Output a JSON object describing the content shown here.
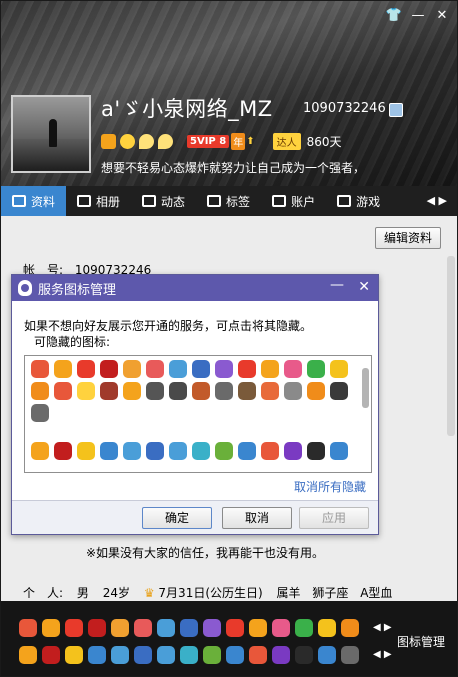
{
  "window": {
    "title_buttons": [
      "shirt-icon",
      "minimize-icon",
      "close-icon"
    ]
  },
  "profile": {
    "nickname": "a'ゞ小泉网络_MZ",
    "qq_number": "1090732246",
    "vip_badge": "5VIP 8",
    "year_badge": "年",
    "daren_label": "达人",
    "days": "860天",
    "signature": "想要不轻易心态爆炸就努力让自己成为一个强者，"
  },
  "tabs": [
    {
      "label": "资料",
      "icon": "card-icon",
      "active": true
    },
    {
      "label": "相册",
      "icon": "photo-icon"
    },
    {
      "label": "动态",
      "icon": "list-icon"
    },
    {
      "label": "标签",
      "icon": "bookmark-icon"
    },
    {
      "label": "账户",
      "icon": "wallet-icon"
    },
    {
      "label": "游戏",
      "icon": "game-icon"
    }
  ],
  "content": {
    "edit_button": "编辑资料",
    "account_label": "帐　号:",
    "account_value": "1090732246",
    "quote": "※如果没有大家的信任，我再能干也没有用。",
    "personal_label": "个　人:",
    "gender": "男",
    "age": "24岁",
    "birthday": "7月31日(公历生日)",
    "zodiac": "属羊",
    "constellation": "狮子座",
    "blood": "A型血"
  },
  "dialog": {
    "title": "服务图标管理",
    "desc": "如果不想向好友展示您开通的服务，可点击将其隐藏。",
    "hideable_label": "可隐藏的图标:",
    "show_all": "取消所有隐藏",
    "ok": "确定",
    "cancel": "取消",
    "apply": "应用"
  },
  "bottom": {
    "manage_label": "图标管理"
  },
  "colors": {
    "tab_active": "#3a86cf",
    "dialog_title": "#5d58ac",
    "link": "#3a6dc2"
  }
}
